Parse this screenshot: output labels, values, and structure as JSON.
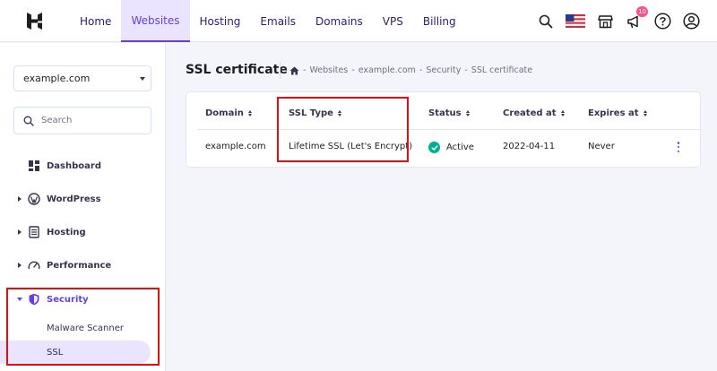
{
  "nav": {
    "items": [
      "Home",
      "Websites",
      "Hosting",
      "Emails",
      "Domains",
      "VPS",
      "Billing"
    ],
    "active_index": 1,
    "notification_count": "10"
  },
  "icons": {
    "logo": "hostinger-logo",
    "search": "search-icon",
    "flag": "us-flag-icon",
    "store": "store-icon",
    "megaphone": "megaphone-icon",
    "help": "help-icon",
    "account": "account-icon"
  },
  "sidebar": {
    "domain": "example.com",
    "search_placeholder": "Search",
    "items": [
      {
        "label": "Dashboard",
        "icon": "dashboard-icon"
      },
      {
        "label": "WordPress",
        "icon": "wordpress-icon"
      },
      {
        "label": "Hosting",
        "icon": "server-icon"
      },
      {
        "label": "Performance",
        "icon": "gauge-icon"
      },
      {
        "label": "Security",
        "icon": "shield-icon"
      }
    ],
    "security_subitems": [
      "Malware Scanner",
      "SSL"
    ]
  },
  "main": {
    "title": "SSL certificate",
    "breadcrumb": [
      "Websites",
      "example.com",
      "Security",
      "SSL certificate"
    ],
    "table": {
      "headers": [
        "Domain",
        "SSL Type",
        "Status",
        "Created at",
        "Expires at"
      ],
      "rows": [
        {
          "domain": "example.com",
          "ssl_type": "Lifetime SSL (Let's Encrypt)",
          "status": "Active",
          "created_at": "2022-04-11",
          "expires_at": "Never"
        }
      ]
    }
  },
  "colors": {
    "accent": "#673de6",
    "accent_light": "#ebe4ff",
    "success": "#00b090",
    "highlight": "#e01010"
  }
}
